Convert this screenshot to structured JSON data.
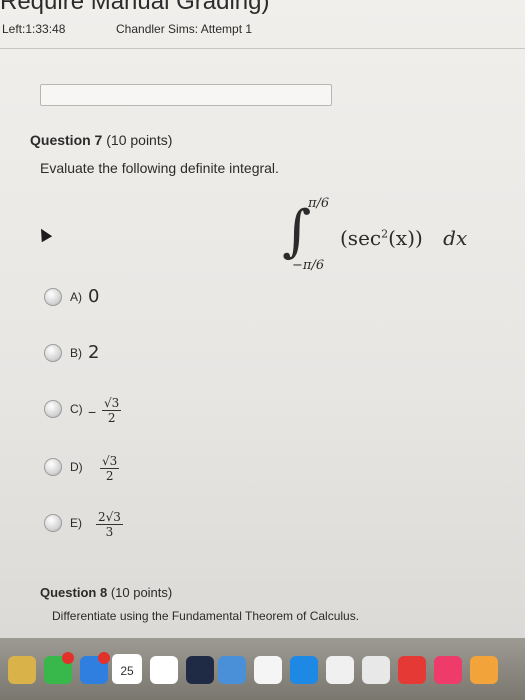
{
  "header": {
    "title": "Require Manual Grading)",
    "time_left": "Left:1:33:48",
    "student_attempt": "Chandler Sims: Attempt 1"
  },
  "question7": {
    "number": "Question 7",
    "points": "(10 points)",
    "prompt": "Evaluate the following definite integral.",
    "integral": {
      "upper": "π/6",
      "lower": "−π/6",
      "integrand": "(sec",
      "power": "2",
      "integrand_tail": "(x))",
      "dx": "dx"
    },
    "options": [
      {
        "letter": "A)",
        "value": "0"
      },
      {
        "letter": "B)",
        "value": "2"
      },
      {
        "letter": "C)",
        "sign": "−",
        "num": "√3",
        "den": "2"
      },
      {
        "letter": "D)",
        "num": "√3",
        "den": "2"
      },
      {
        "letter": "E)",
        "num": "2√3",
        "den": "3"
      }
    ]
  },
  "question8": {
    "number": "Question 8",
    "points": "(10 points)",
    "prompt": "Differentiate using the Fundamental Theorem of Calculus."
  },
  "dock": {
    "date": "25"
  }
}
